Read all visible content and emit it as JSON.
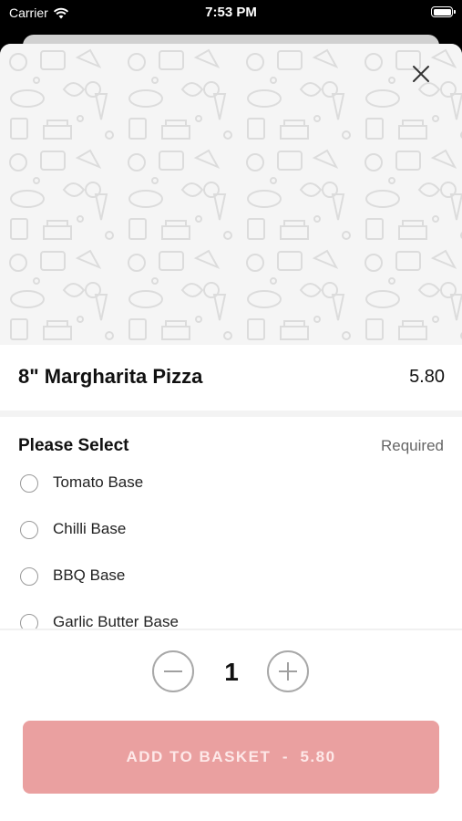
{
  "status_bar": {
    "carrier": "Carrier",
    "time": "7:53 PM"
  },
  "item": {
    "name": "8\" Margharita Pizza",
    "price": "5.80"
  },
  "options_group": {
    "title": "Please Select",
    "required_label": "Required",
    "options": [
      {
        "label": "Tomato Base",
        "selected": false
      },
      {
        "label": "Chilli Base",
        "selected": false
      },
      {
        "label": "BBQ Base",
        "selected": false
      },
      {
        "label": "Garlic Butter Base",
        "selected": false
      }
    ]
  },
  "quantity": {
    "value": "1"
  },
  "add_button": {
    "label": "ADD TO BASKET  -  5.80"
  },
  "colors": {
    "accent": "#eaa0a0",
    "hero_bg": "#f5f5f5"
  }
}
